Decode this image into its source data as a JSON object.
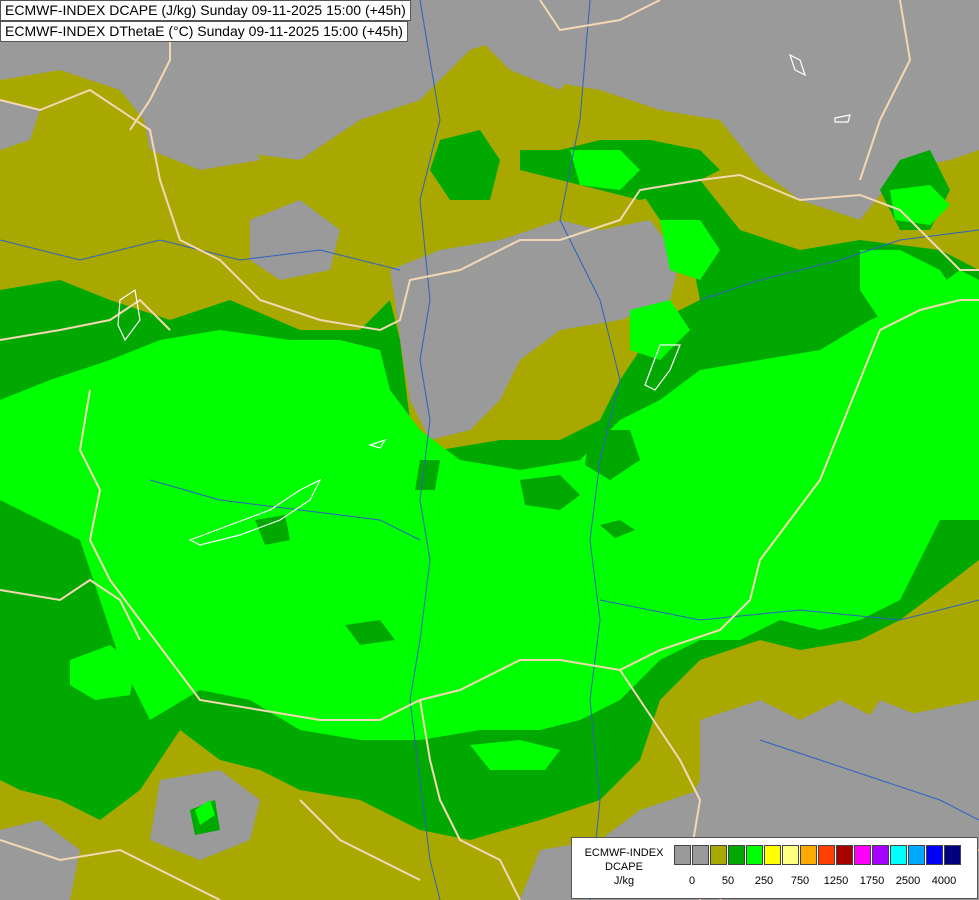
{
  "titles": {
    "line1": "ECMWF-INDEX DCAPE (J/kg) Sunday 09-11-2025 15:00 (+45h)",
    "line2": "ECMWF-INDEX DThetaE (°C) Sunday 09-11-2025 15:00 (+45h)"
  },
  "legend": {
    "label_line1": "ECMWF-INDEX",
    "label_line2": "DCAPE",
    "label_line3": "J/kg",
    "colors": [
      "#9a9a9a",
      "#9a9a9a",
      "#a8a800",
      "#00a800",
      "#00ff00",
      "#ffff00",
      "#ffff80",
      "#ffa800",
      "#ff4000",
      "#a80000",
      "#ff00ff",
      "#a800ff",
      "#00ffff",
      "#00a8ff",
      "#0000ff",
      "#000080"
    ],
    "ticks": [
      "0",
      "50",
      "250",
      "750",
      "1250",
      "1750",
      "2500",
      "4000"
    ]
  },
  "map_colors": {
    "background": "#9a9a9a",
    "low": "#a8a800",
    "mid": "#00a800",
    "high": "#00ff00",
    "borders": "#f4d7b4",
    "rivers": "#3060c0"
  }
}
